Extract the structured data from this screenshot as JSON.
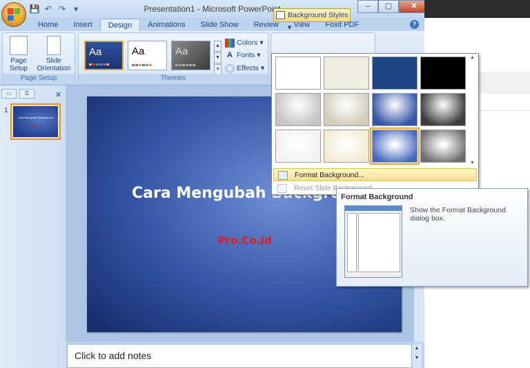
{
  "window": {
    "title": "Presentation1 - Microsoft PowerPoint",
    "controls": {
      "minimize": "–",
      "maximize": "▢",
      "close": "✕"
    },
    "help": "?"
  },
  "quick_access": {
    "save_icon": "save-icon",
    "undo_icon": "undo-icon",
    "redo_icon": "redo-icon"
  },
  "tabs": [
    "Home",
    "Insert",
    "Design",
    "Animations",
    "Slide Show",
    "Review",
    "View",
    "Foxit PDF"
  ],
  "active_tab": "Design",
  "ribbon": {
    "page_setup": {
      "page_setup_label": "Page Setup",
      "slide_orientation_label": "Slide Orientation",
      "group_label": "Page Setup"
    },
    "themes": {
      "preview_text": "Aa",
      "group_label": "Themes",
      "colors_label": "Colors",
      "fonts_label": "Fonts",
      "effects_label": "Effects"
    },
    "background_styles_label": "Background Styles"
  },
  "gallery": {
    "swatches": [
      "#ffffff",
      "#efece4",
      "#1f4583",
      "#000000",
      "#c5c5c5",
      "#d2ccbb",
      "#3657a7",
      "#3d3d3d",
      "#f2f2f2",
      "#f2ead2",
      "#4466bd",
      "#6b6b6b"
    ],
    "selected_index": 10,
    "format_background": "Format Background...",
    "reset_background": "Reset Slide Background"
  },
  "tooltip": {
    "title": "Format Background",
    "description": "Show the Format Background dialog box."
  },
  "slide_panel": {
    "slide_number": "1",
    "thumb_title": "Cara Mengubah Background",
    "thumb_subtitle": "Pro.Co.Id"
  },
  "slide": {
    "title": "Cara Mengubah Background",
    "subtitle": "Pro.Co.Id"
  },
  "notes": {
    "placeholder": "Click to add notes"
  },
  "colors": {
    "accent": "#15428b",
    "highlight": "#fde08f",
    "subtitle_red": "#e21a1a"
  }
}
